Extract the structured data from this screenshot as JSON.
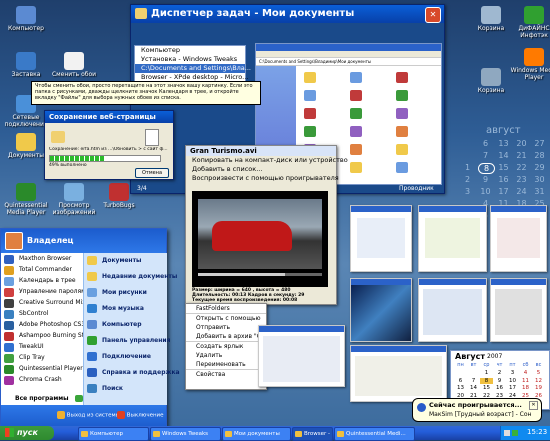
{
  "desktop_icons": [
    {
      "label": "Компьютер",
      "color": "#5b8ad2"
    },
    {
      "label": "Заставка",
      "color": "#3a7ac8"
    },
    {
      "label": "Сменить обои",
      "color": "#f2f2f2"
    },
    {
      "label": "Сетевые подключения",
      "color": "#4a90d9"
    },
    {
      "label": "Корзина",
      "color": "#9fb8d0"
    },
    {
      "label": "Документы",
      "color": "#f0c94a"
    },
    {
      "label": "Quintessential Media Player",
      "color": "#2a8a2a"
    },
    {
      "label": "Просмотр изображений",
      "color": "#7ab0e0"
    },
    {
      "label": "TurboBugs",
      "color": "#c03030"
    },
    {
      "label": "Корзина",
      "color": "#8fa8c0"
    },
    {
      "label": "ДиФАЙНС Инфотэк",
      "color": "#30a030"
    },
    {
      "label": "Windows Media Player",
      "color": "#ff7a00"
    }
  ],
  "taskmanager": {
    "title": "Диспетчер задач - Мои документы",
    "list": [
      "Компьютер",
      "Установка - Windows Tweaks",
      "C:\\Documents and Settings\\Вла...",
      "Browser - XPde desktop - Micro..."
    ],
    "tooltip": "Чтобы сменить обои, просто перетащите на этот значок вашу картинку. Если это папка с рисунками, дважды щелкните значок Календаря в трее, и откройте вкладку \"Файлы\" для выбора нужных обоев из списка.",
    "status_left": "3/4",
    "status_right": "Проводник",
    "addr": "C:\\Documents and Settings\\Владимир\\Мои документы"
  },
  "save_dialog": {
    "title": "Сохранение веб-страницы",
    "text": "Сохранение: erfa.htm из ...\\Обновить > с сайт ф...",
    "progress_text": "49% выполнено",
    "progress": 0.49,
    "cancel": "Отмена"
  },
  "video": {
    "title": "Gran Turismo.avi",
    "items": [
      "Копировать на компакт-диск или устройство",
      "Добавить в список...",
      "Воспроизвести с помощью проигрывателя"
    ],
    "info": [
      "Размер: ширина = 640 , высота = 480",
      "Длительность: 00:13   Кадров в секунду: 29",
      "Текущее время воспроизведения: 00:08"
    ],
    "ctx": [
      "FastFolders",
      "Открыть с помощью",
      "Отправить",
      "Добавить в архив \"Gran Turismo.rar\"",
      "Создать ярлык",
      "Удалить",
      "Переименовать",
      "Свойства"
    ]
  },
  "startmenu": {
    "user": "Владелец",
    "left": [
      "Maxthon Browser",
      "Total Commander",
      "Календарь в трее",
      "Управление паролями",
      "Creative Surround Mixer",
      "SbControl",
      "Adobe Photoshop CS3",
      "Ashampoo Burning Studio",
      "TweakUI",
      "Clip Tray",
      "Quintessential Player",
      "Chroma Crash"
    ],
    "all_programs": "Все программы",
    "right": [
      "Документы",
      "Недавние документы",
      "Мои рисунки",
      "Моя музыка",
      "Компьютер",
      "Панель управления",
      "Подключение",
      "Справка и поддержка",
      "Поиск"
    ],
    "logoff": "Выход из системы",
    "shutdown": "Выключение"
  },
  "calendar_big": {
    "month": "август",
    "rows": [
      [
        "6",
        "13",
        "20",
        "27"
      ],
      [
        "7",
        "14",
        "21",
        "28"
      ],
      [
        "1",
        "8",
        "15",
        "22",
        "29"
      ],
      [
        "2",
        "9",
        "16",
        "23",
        "30"
      ],
      [
        "3",
        "10",
        "17",
        "24",
        "31"
      ],
      [
        "4",
        "11",
        "18",
        "25"
      ],
      [
        "5",
        "12",
        "19",
        "26"
      ]
    ],
    "today": "8"
  },
  "calendar_small": {
    "month": "Август",
    "year": "2007",
    "days": [
      "пн",
      "вт",
      "ср",
      "чт",
      "пт",
      "сб",
      "вс"
    ],
    "dates": [
      "",
      "",
      "1",
      "2",
      "3",
      "4",
      "5",
      "6",
      "7",
      "8",
      "9",
      "10",
      "11",
      "12",
      "13",
      "14",
      "15",
      "16",
      "17",
      "18",
      "19",
      "20",
      "21",
      "22",
      "23",
      "24",
      "25",
      "26",
      "27",
      "28",
      "29",
      "30",
      "31"
    ],
    "today": "8"
  },
  "balloon": {
    "title": "Сейчас проигрывается...",
    "text": "МакSim [Трудный возраст] - Сон"
  },
  "taskbar": {
    "start": "пуск",
    "buttons": [
      "Компьютер",
      "Windows Tweaks",
      "Мои документы",
      "Browser - xp desk...",
      "Quintessential Medi..."
    ],
    "clock": "15:23"
  }
}
